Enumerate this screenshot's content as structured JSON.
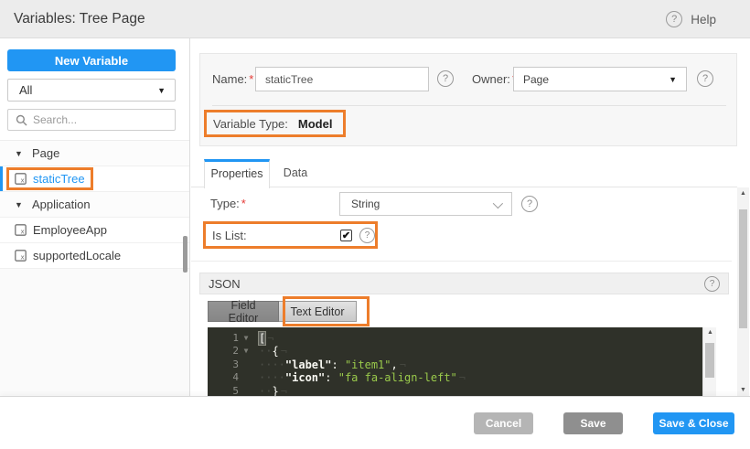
{
  "header": {
    "title": "Variables: Tree Page",
    "help_label": "Help"
  },
  "icons": {
    "help_glyph": "?",
    "caret_down": "▼",
    "group_caret": "▼",
    "check_glyph": "✔",
    "scroll_up": "▲",
    "scroll_down": "▼",
    "fold_caret": "▼"
  },
  "colors": {
    "accent_blue": "#2196f3",
    "annotation_orange": "#ed7d2b",
    "code_string_green": "#9aca4b",
    "editor_background": "#2f3129"
  },
  "sidebar": {
    "new_variable_button": "New Variable",
    "filter_value": "All",
    "search_placeholder": "Search...",
    "tree": [
      {
        "kind": "group",
        "label": "Page"
      },
      {
        "kind": "item",
        "label": "staticTree",
        "selected": true,
        "annotated": true
      },
      {
        "kind": "group",
        "label": "Application"
      },
      {
        "kind": "item",
        "label": "EmployeeApp"
      },
      {
        "kind": "item",
        "label": "supportedLocale"
      }
    ]
  },
  "form": {
    "required_mark": "*",
    "name_label": "Name:",
    "name_value": "staticTree",
    "owner_label": "Owner:",
    "owner_value": "Page",
    "variable_type_label": "Variable Type:",
    "variable_type_value": "Model"
  },
  "tabs": [
    {
      "label": "Properties",
      "active": true
    },
    {
      "label": "Data",
      "active": false
    }
  ],
  "properties": {
    "type_label": "Type:",
    "type_value": "String",
    "is_list_label": "Is List:",
    "is_list_checked": true
  },
  "json_section": {
    "title": "JSON",
    "editor_modes": [
      {
        "label": "Field Editor",
        "active": false
      },
      {
        "label": "Text Editor",
        "active": true,
        "annotated": true
      }
    ],
    "code_lines": [
      {
        "num": "1",
        "fold": true,
        "tokens": [
          {
            "t": "hl",
            "v": "["
          }
        ]
      },
      {
        "num": "2",
        "fold": true,
        "tokens": [
          {
            "t": "ws",
            "v": "  "
          },
          {
            "t": "pun",
            "v": "{"
          }
        ]
      },
      {
        "num": "3",
        "fold": false,
        "tokens": [
          {
            "t": "ws",
            "v": "    "
          },
          {
            "t": "key",
            "v": "\"label\""
          },
          {
            "t": "pun",
            "v": ": "
          },
          {
            "t": "str",
            "v": "\"item1\""
          },
          {
            "t": "pun",
            "v": ","
          }
        ]
      },
      {
        "num": "4",
        "fold": false,
        "tokens": [
          {
            "t": "ws",
            "v": "    "
          },
          {
            "t": "key",
            "v": "\"icon\""
          },
          {
            "t": "pun",
            "v": ": "
          },
          {
            "t": "str",
            "v": "\"fa fa-align-left\""
          }
        ]
      },
      {
        "num": "5",
        "fold": false,
        "tokens": [
          {
            "t": "ws",
            "v": "  "
          },
          {
            "t": "pun",
            "v": "}"
          }
        ]
      }
    ]
  },
  "footer": {
    "buttons": [
      {
        "label": "Cancel",
        "style": "light"
      },
      {
        "label": "Save",
        "style": "dark"
      },
      {
        "label": "Save & Close",
        "style": "primary"
      }
    ]
  }
}
